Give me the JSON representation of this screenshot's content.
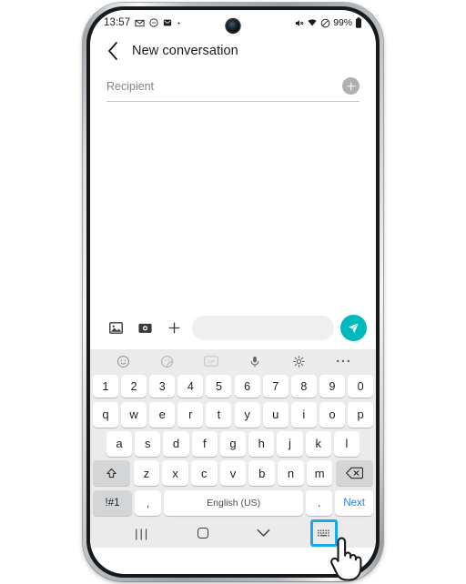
{
  "device": {
    "name": "samsung-galaxy-phone",
    "frame_color": "#b9bec2"
  },
  "status_bar": {
    "time": "13:57",
    "left_icons": [
      "messages-icon",
      "do-not-disturb-icon",
      "mail-icon",
      "dot-indicator"
    ],
    "right_icons": [
      "mute-icon",
      "wifi-icon",
      "dnd-circle-icon"
    ],
    "battery_percent": "99%",
    "battery_icon": "battery-full-icon"
  },
  "header": {
    "back_icon": "back-chevron-icon",
    "title": "New conversation"
  },
  "recipient": {
    "placeholder": "Recipient",
    "value": "",
    "add_icon": "add-contact-plus-icon"
  },
  "compose": {
    "icons": [
      "gallery-icon",
      "camera-icon",
      "plus-icon"
    ],
    "input_placeholder": "",
    "input_value": "",
    "send_icon": "send-paper-plane-icon",
    "send_color": "#00b9bd"
  },
  "keyboard": {
    "toolbar": [
      "emoji-icon",
      "sticker-icon",
      "gif-icon",
      "microphone-icon",
      "settings-gear-icon",
      "more-options-icon"
    ],
    "rows": {
      "numbers": [
        "1",
        "2",
        "3",
        "4",
        "5",
        "6",
        "7",
        "8",
        "9",
        "0"
      ],
      "top": [
        "q",
        "w",
        "e",
        "r",
        "t",
        "y",
        "u",
        "i",
        "o",
        "p"
      ],
      "home": [
        "a",
        "s",
        "d",
        "f",
        "g",
        "h",
        "j",
        "k",
        "l"
      ],
      "bottom": [
        "z",
        "x",
        "c",
        "v",
        "b",
        "n",
        "m"
      ]
    },
    "shift_icon": "shift-arrow-icon",
    "backspace_icon": "backspace-icon",
    "symbols_label": "!#1",
    "comma_label": ",",
    "space_label": "English (US)",
    "period_label": ".",
    "next_label": "Next",
    "next_color": "#2c7de0"
  },
  "nav_bar": {
    "recents_icon": "recents-lines-icon",
    "home_icon": "home-square-icon",
    "back_icon": "hide-keyboard-chevron-icon",
    "keyboard_toggle_icon": "keyboard-switch-icon",
    "highlight_color": "#17a9e8",
    "highlighted_item": "keyboard-switch-icon"
  },
  "cursor": {
    "type": "hand-pointer-cursor"
  }
}
